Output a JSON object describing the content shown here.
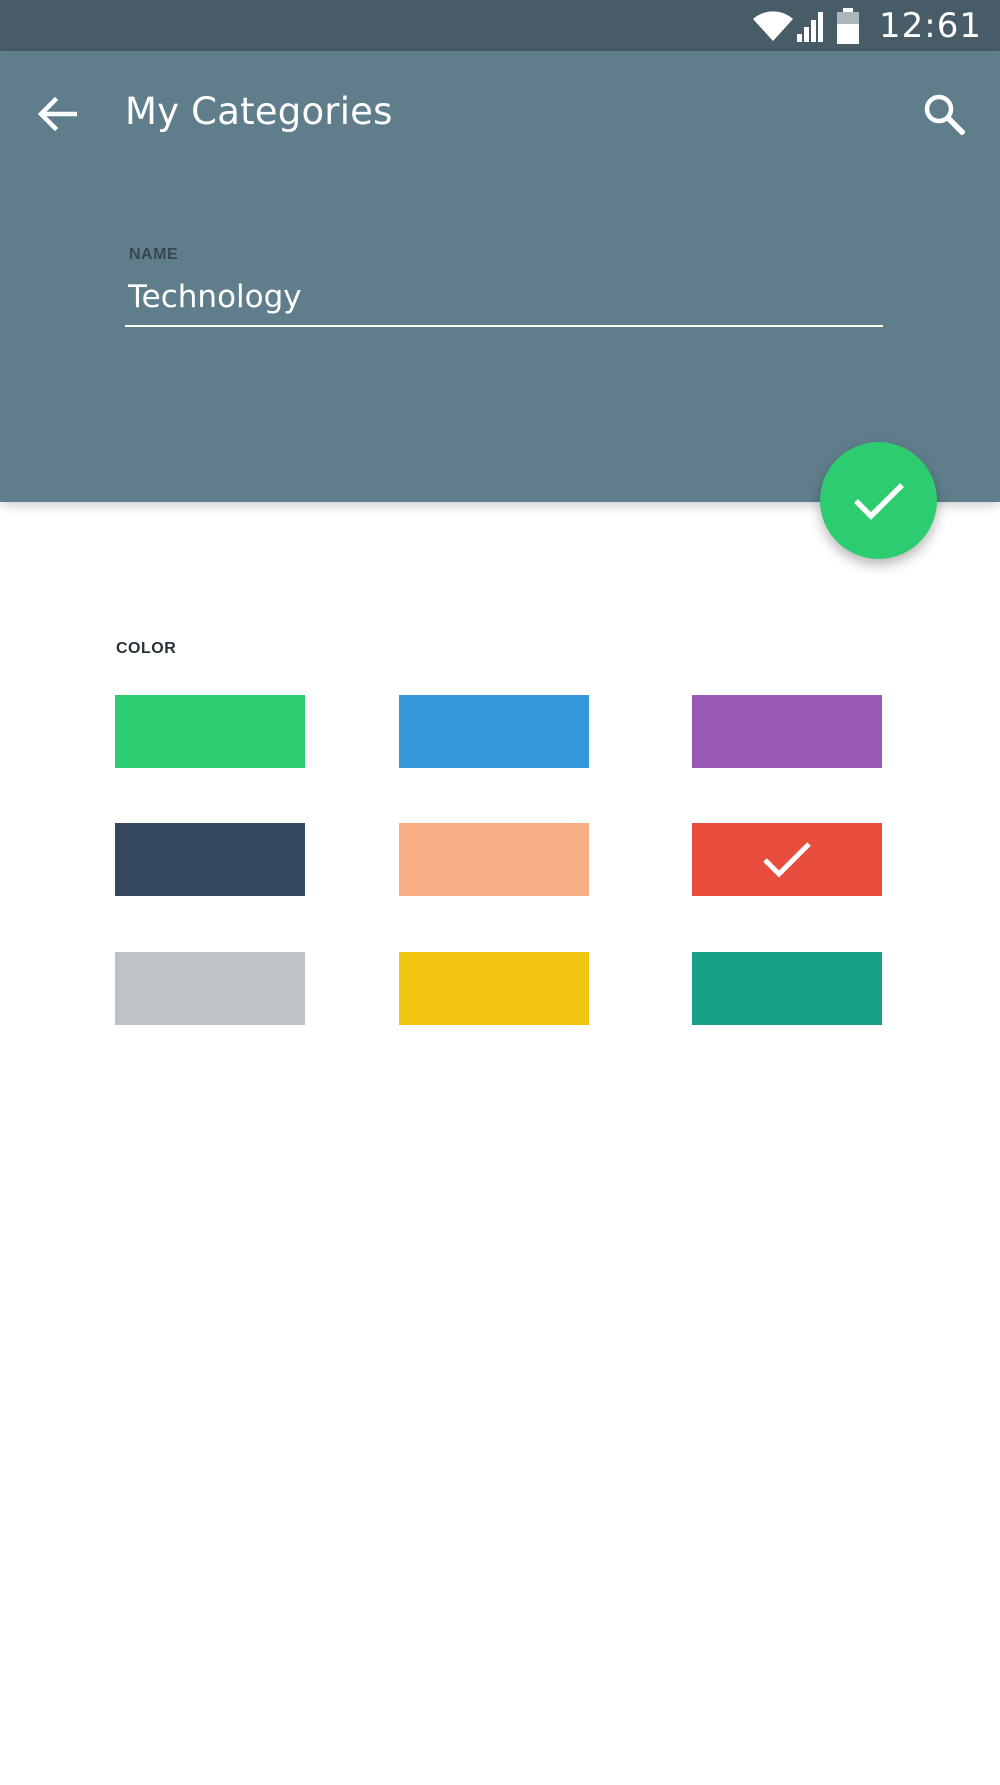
{
  "status_bar": {
    "time": "12:61",
    "icons": [
      "wifi-icon",
      "cell-signal-icon",
      "battery-icon"
    ]
  },
  "toolbar": {
    "title": "My Categories",
    "back_icon": "arrow-left-icon",
    "search_icon": "search-icon"
  },
  "form": {
    "name_label": "NAME",
    "name_value": "Technology",
    "color_label": "COLOR"
  },
  "fab": {
    "icon": "check-icon",
    "color": "#2ecc71"
  },
  "colors": {
    "header": "#607d8b",
    "status_bar": "#485c68"
  },
  "swatches": [
    {
      "color": "#2ecc71",
      "selected": false
    },
    {
      "color": "#3498db",
      "selected": false
    },
    {
      "color": "#9b59b6",
      "selected": false
    },
    {
      "color": "#34495e",
      "selected": false
    },
    {
      "color": "#f8ae84",
      "selected": false
    },
    {
      "color": "#e74c3c",
      "selected": true
    },
    {
      "color": "#bdc3c7",
      "selected": false
    },
    {
      "color": "#f1c40f",
      "selected": false
    },
    {
      "color": "#16a085",
      "selected": false
    }
  ]
}
